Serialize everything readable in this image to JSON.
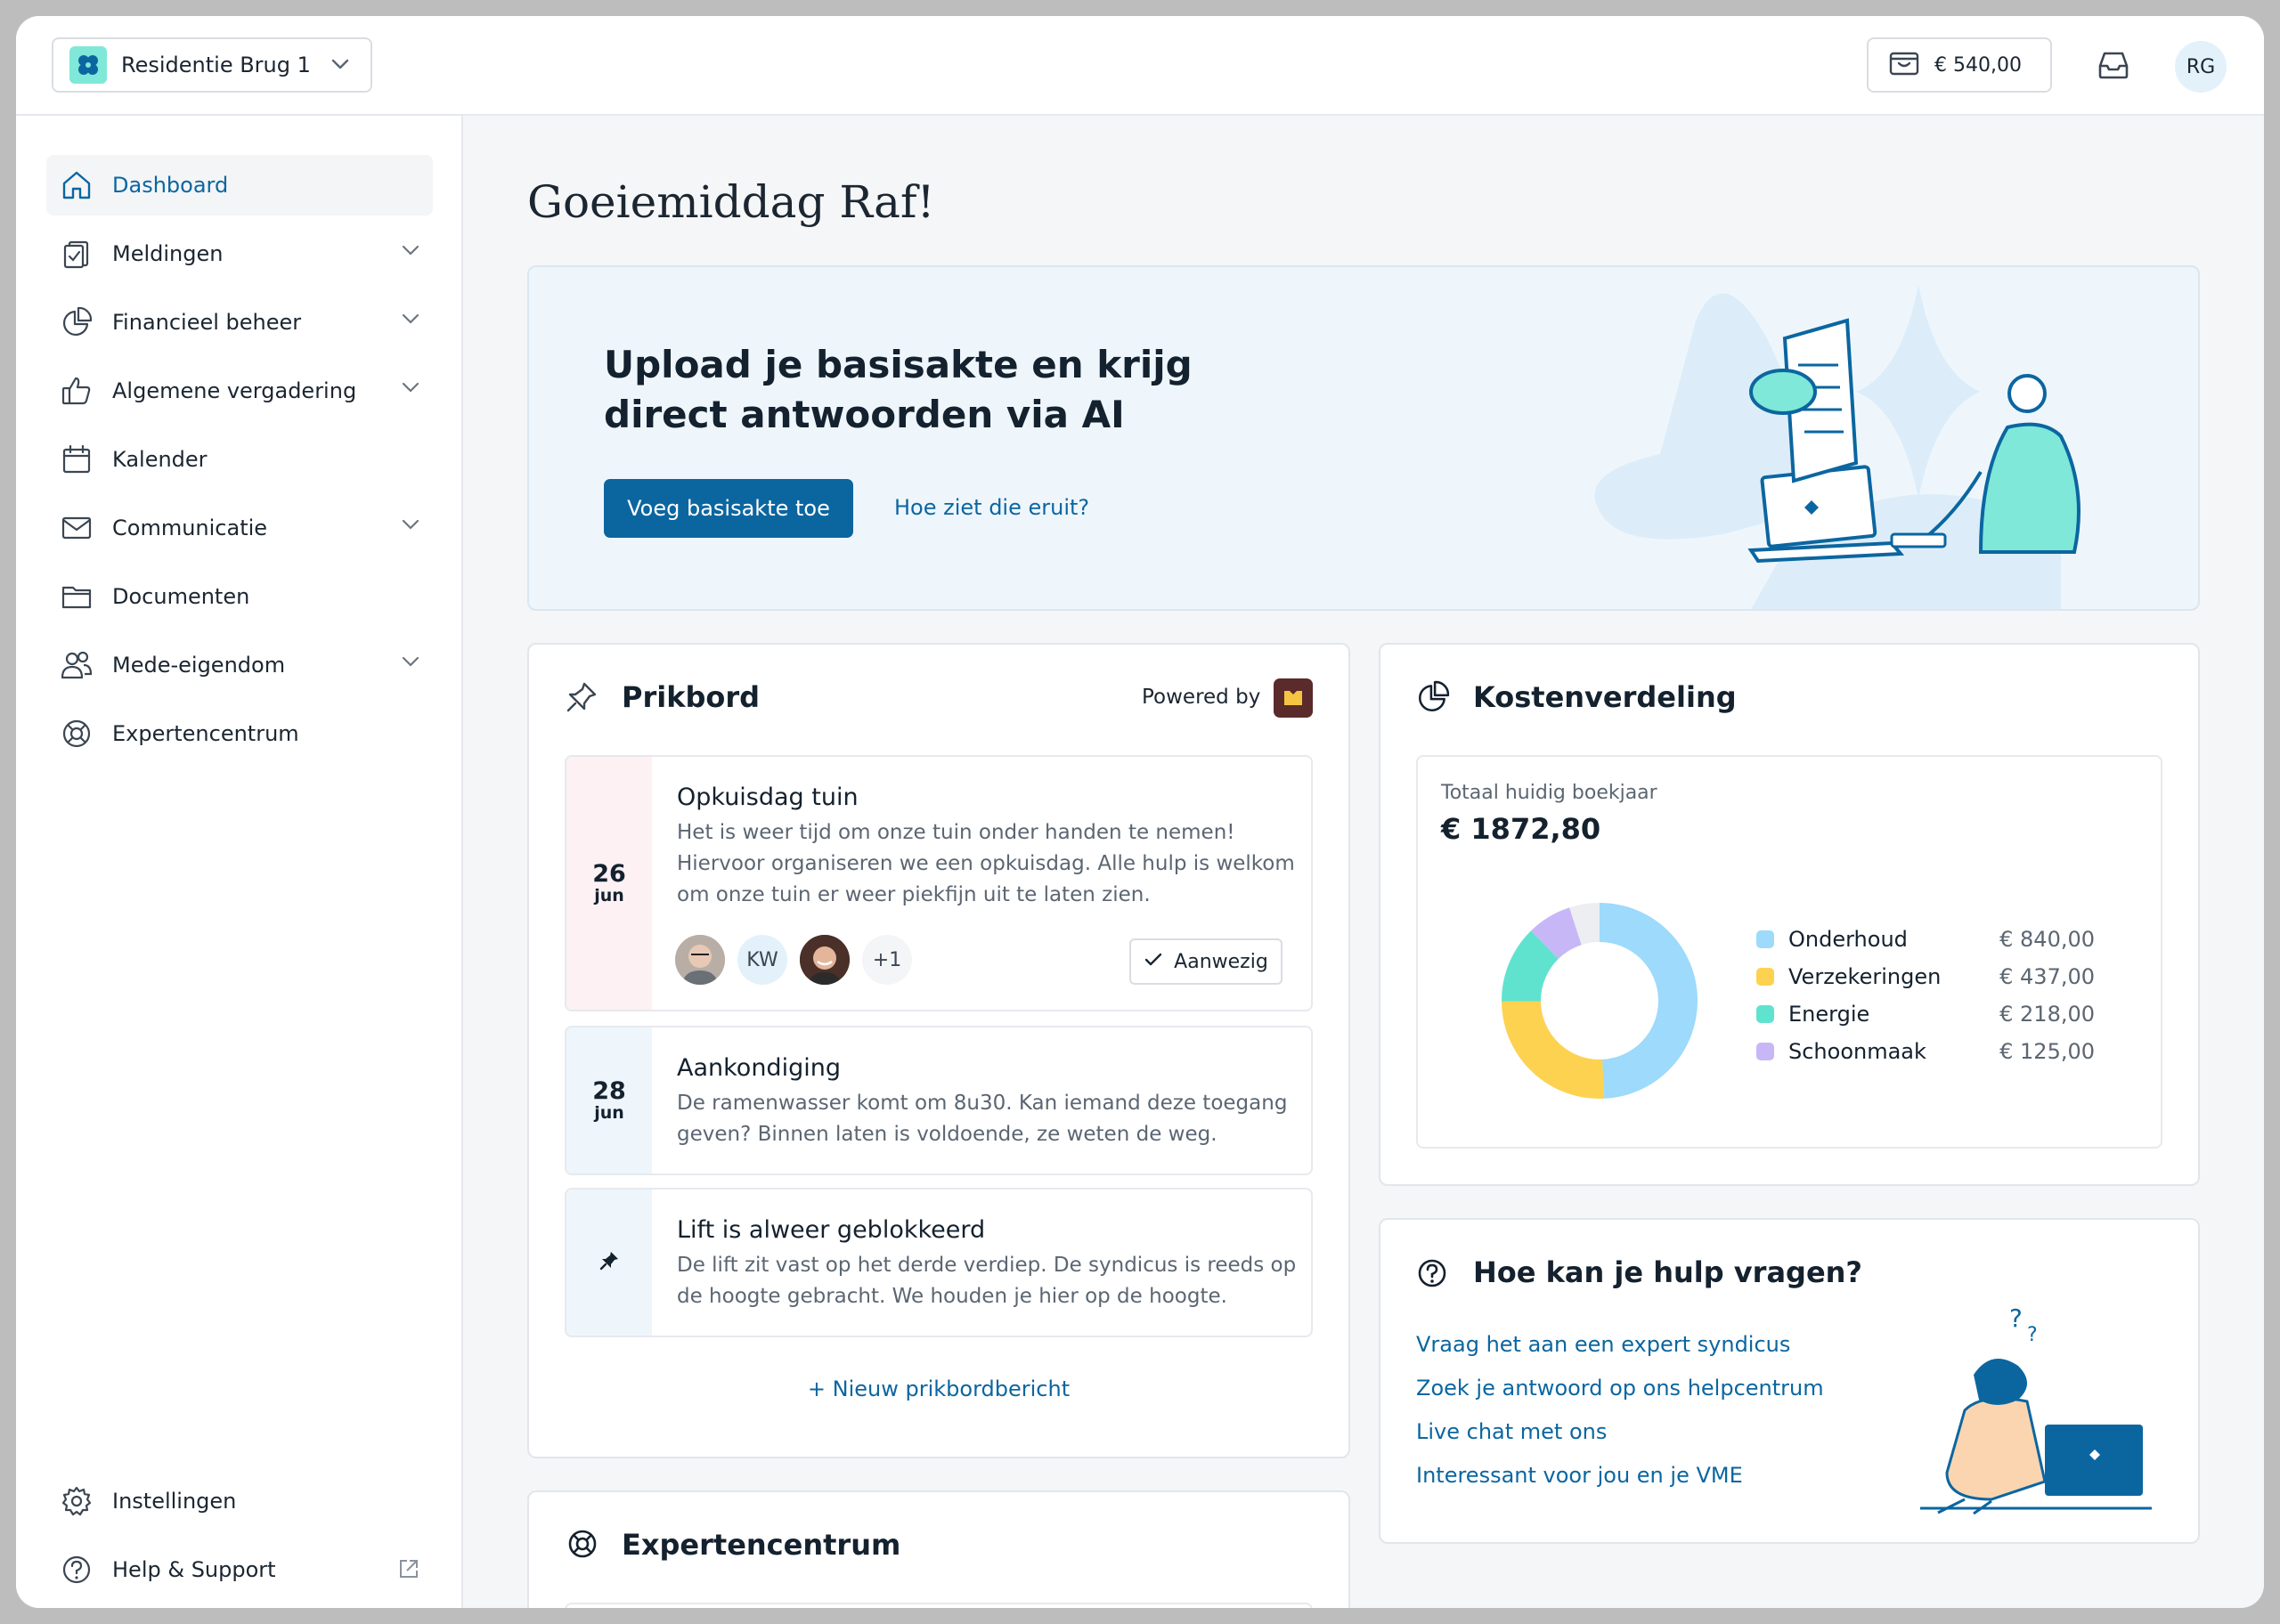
{
  "topbar": {
    "building_name": "Residentie Brug 1",
    "wallet_amount": "€ 540,00",
    "user_initials": "RG"
  },
  "sidebar": {
    "items": [
      {
        "label": "Dashboard",
        "icon": "home-icon",
        "active": true
      },
      {
        "label": "Meldingen",
        "icon": "clipboard-icon",
        "expandable": true
      },
      {
        "label": "Financieel beheer",
        "icon": "pie-chart-icon",
        "expandable": true
      },
      {
        "label": "Algemene vergadering",
        "icon": "thumbs-up-icon",
        "expandable": true
      },
      {
        "label": "Kalender",
        "icon": "calendar-icon"
      },
      {
        "label": "Communicatie",
        "icon": "mail-icon",
        "expandable": true
      },
      {
        "label": "Documenten",
        "icon": "folder-icon"
      },
      {
        "label": "Mede-eigendom",
        "icon": "users-icon",
        "expandable": true
      },
      {
        "label": "Expertencentrum",
        "icon": "lifebuoy-icon"
      }
    ],
    "bottom": [
      {
        "label": "Instellingen",
        "icon": "gear-icon"
      },
      {
        "label": "Help & Support",
        "icon": "help-circle-icon",
        "external": true
      }
    ]
  },
  "main": {
    "greeting": "Goeiemiddag Raf!",
    "banner": {
      "title": "Upload je basisakte en krijg direct antwoorden via AI",
      "primary_button": "Voeg basisakte toe",
      "secondary_link": "Hoe ziet die eruit?"
    },
    "pinboard": {
      "title": "Prikbord",
      "powered_by": "Powered by",
      "posts": [
        {
          "day": "26",
          "month": "jun",
          "title": "Opkuisdag tuin",
          "body": "Het is weer tijd om onze tuin onder handen te nemen! Hiervoor organiseren we een opkuisdag. Alle hulp is welkom om onze tuin er weer piekfijn uit te laten zien.",
          "attendee_initials": "KW",
          "more_count": "+1",
          "attend_label": "Aanwezig"
        },
        {
          "day": "28",
          "month": "jun",
          "title": "Aankondiging",
          "body": "De ramenwasser komt om 8u30. Kan iemand deze toegang geven? Binnen laten is voldoende, ze weten de weg."
        },
        {
          "pinned": true,
          "title": "Lift is alweer geblokkeerd",
          "body": "De lift zit vast op het derde verdiep. De syndicus is reeds op de hoogte gebracht. We houden je hier op de hoogte."
        }
      ],
      "new_post_link": "+ Nieuw prikbordbericht"
    },
    "costs": {
      "title": "Kostenverdeling",
      "total_label": "Totaal huidig boekjaar",
      "total_value": "€ 1872,80"
    },
    "help": {
      "title": "Hoe kan je hulp vragen?",
      "links": [
        "Vraag het aan een expert syndicus",
        "Zoek je antwoord op ons helpcentrum",
        "Live chat met ons",
        "Interessant voor jou en je VME"
      ]
    },
    "expertencentrum": {
      "title": "Expertencentrum"
    }
  },
  "chart_data": {
    "type": "pie",
    "categories": [
      "Onderhoud",
      "Verzekeringen",
      "Energie",
      "Schoonmaak"
    ],
    "values": [
      840.0,
      437.0,
      218.0,
      125.0
    ],
    "value_labels": [
      "€ 840,00",
      "€ 437,00",
      "€ 218,00",
      "€ 125,00"
    ],
    "colors": [
      "#9ddafc",
      "#fdd250",
      "#5fe3cf",
      "#c7b7f7"
    ],
    "remainder_color": "#eceef1",
    "legend": "right"
  },
  "colors": {
    "accent": "#0b66a0",
    "brand_mint": "#7fe8d8"
  }
}
